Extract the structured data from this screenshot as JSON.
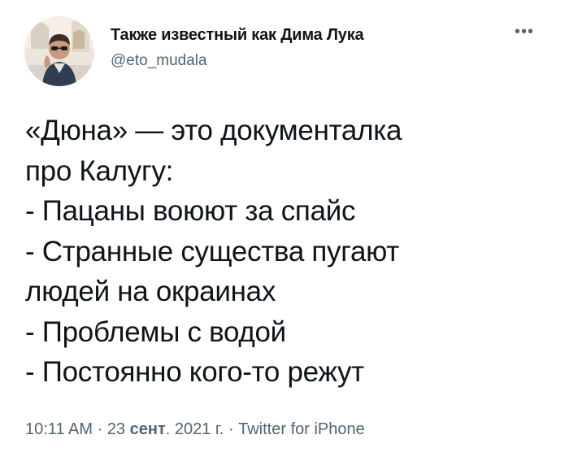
{
  "author": {
    "display_name": "Также известный как Дима Лука",
    "handle": "@eto_mudala"
  },
  "more_menu_icon": "more-horizontal-icon",
  "tweet": {
    "lines": [
      "«Дюна» — это документалка",
      "про Калугу:",
      "- Пацаны воюют за спайс",
      "- Странные существа пугают",
      "людей на окраинах",
      "- Проблемы с водой",
      "- Постоянно кого-то режут"
    ]
  },
  "meta": {
    "time": "10:11 AM",
    "separator": " · ",
    "date_day": "23 ",
    "date_month": "сент",
    "date_rest": ". 2021 г.",
    "source": "Twitter for iPhone"
  },
  "colors": {
    "text_primary": "#0f1419",
    "text_secondary": "#536471",
    "background": "#ffffff"
  }
}
